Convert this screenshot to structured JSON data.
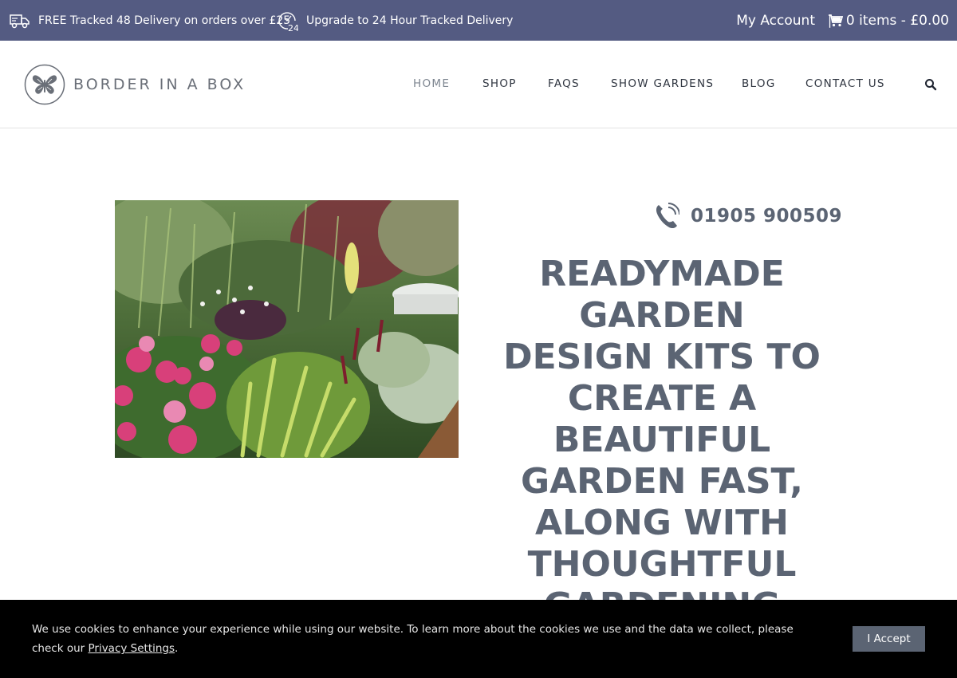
{
  "topbar": {
    "delivery_text": "FREE Tracked 48 Delivery on orders over £25",
    "delivery_icon": "truck-icon",
    "upgrade_text": "Upgrade to 24 Hour Tracked Delivery",
    "upgrade_icon": "clock-24-icon",
    "account_label": "My Account",
    "separator": "|",
    "cart_label": "0 items - £0.00",
    "cart_icon": "cart-icon",
    "bg_color": "#545b82"
  },
  "header": {
    "logo_text": "BORDER IN A BOX",
    "logo_icon": "butterfly-icon",
    "nav": [
      {
        "label": "HOME",
        "active": true
      },
      {
        "label": "SHOP"
      },
      {
        "label": "FAQS"
      },
      {
        "label": "SHOW GARDENS"
      },
      {
        "label": "BLOG"
      },
      {
        "label": "CONTACT US"
      }
    ],
    "search_icon": "search-icon"
  },
  "main": {
    "phone_icon": "phone-icon",
    "phone_number": "01905 900509",
    "headline": "READYMADE GARDEN DESIGN KITS TO CREATE A BEAUTIFUL GARDEN FAST, ALONG WITH THOUGHTFUL GARDENING GIFTS",
    "text_color": "#5b6473"
  },
  "cookie": {
    "text": "We use cookies to enhance your experience while using our website. To learn more about the cookies we use and the data we collect, please check our ",
    "link_text": "Privacy Settings",
    "text_after": ".",
    "accept_label": "I Accept"
  }
}
